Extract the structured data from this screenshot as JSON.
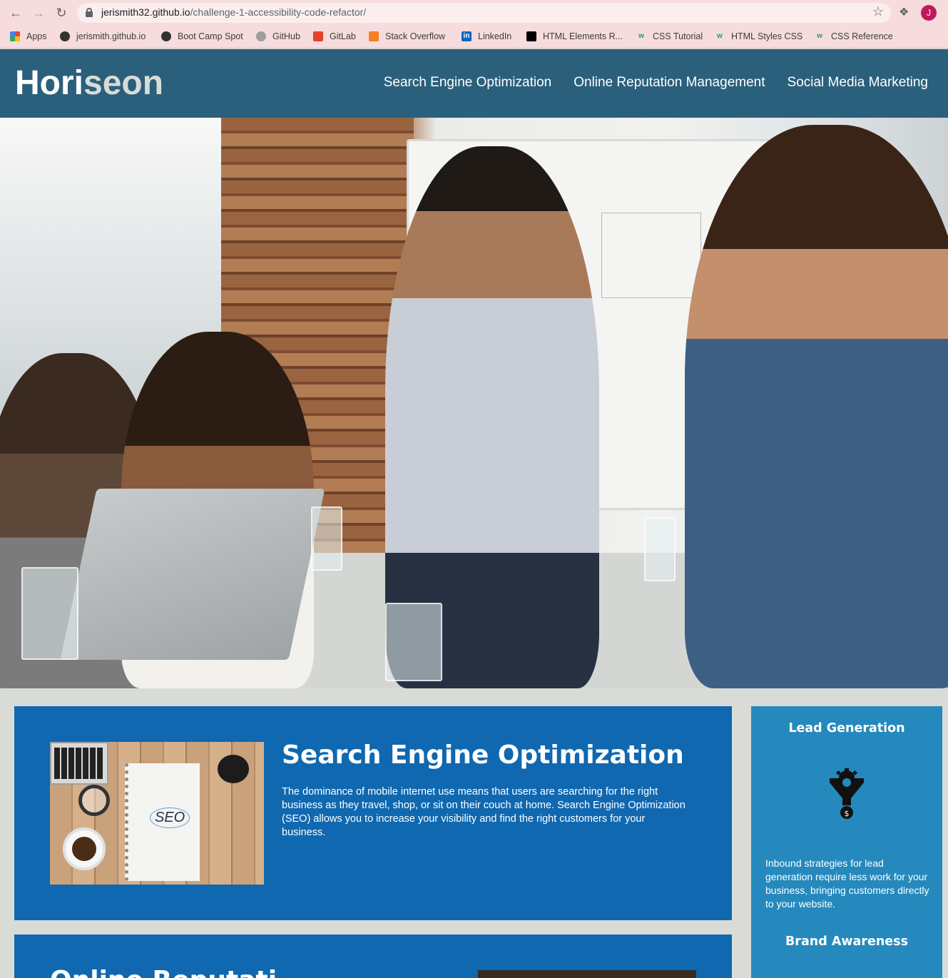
{
  "browser": {
    "url_host": "jerismith32.github.io",
    "url_path": "/challenge-1-accessibility-code-refactor/",
    "profile_initial": "J",
    "bookmarks": [
      {
        "label": "Apps",
        "icon": "apps-grid-icon"
      },
      {
        "label": "jerismith.github.io",
        "icon": "globe-icon"
      },
      {
        "label": "Boot Camp Spot",
        "icon": "globe-icon"
      },
      {
        "label": "GitHub",
        "icon": "github-icon"
      },
      {
        "label": "GitLab",
        "icon": "gitlab-icon"
      },
      {
        "label": "Stack Overflow",
        "icon": "stackoverflow-icon"
      },
      {
        "label": "LinkedIn",
        "icon": "linkedin-icon"
      },
      {
        "label": "HTML Elements R...",
        "icon": "mdn-icon"
      },
      {
        "label": "CSS Tutorial",
        "icon": "w3schools-icon"
      },
      {
        "label": "HTML Styles CSS",
        "icon": "w3schools-icon"
      },
      {
        "label": "CSS Reference",
        "icon": "w3schools-icon"
      }
    ]
  },
  "header": {
    "logo_part1": "Hori",
    "logo_part2": "seon",
    "nav": [
      {
        "label": "Search Engine Optimization"
      },
      {
        "label": "Online Reputation Management"
      },
      {
        "label": "Social Media Marketing"
      }
    ]
  },
  "content": {
    "seo": {
      "title": "Search Engine Optimization",
      "text": "The dominance of mobile internet use means that users are searching for the right business as they travel, shop, or sit on their couch at home. Search Engine Optimization (SEO) allows you to increase your visibility and find the right customers for your business.",
      "image_word": "SEO"
    },
    "orm": {
      "title": "Online Reputati"
    }
  },
  "aside": {
    "lead_title": "Lead Generation",
    "lead_text": "Inbound strategies for lead generation require less work for your business, bringing customers directly to your website.",
    "brand_title": "Brand Awareness"
  },
  "colors": {
    "header_bg": "#2a607c",
    "card_bg": "#0f68b0",
    "aside_bg": "#2589bd",
    "page_bg": "#d9dcd6"
  }
}
